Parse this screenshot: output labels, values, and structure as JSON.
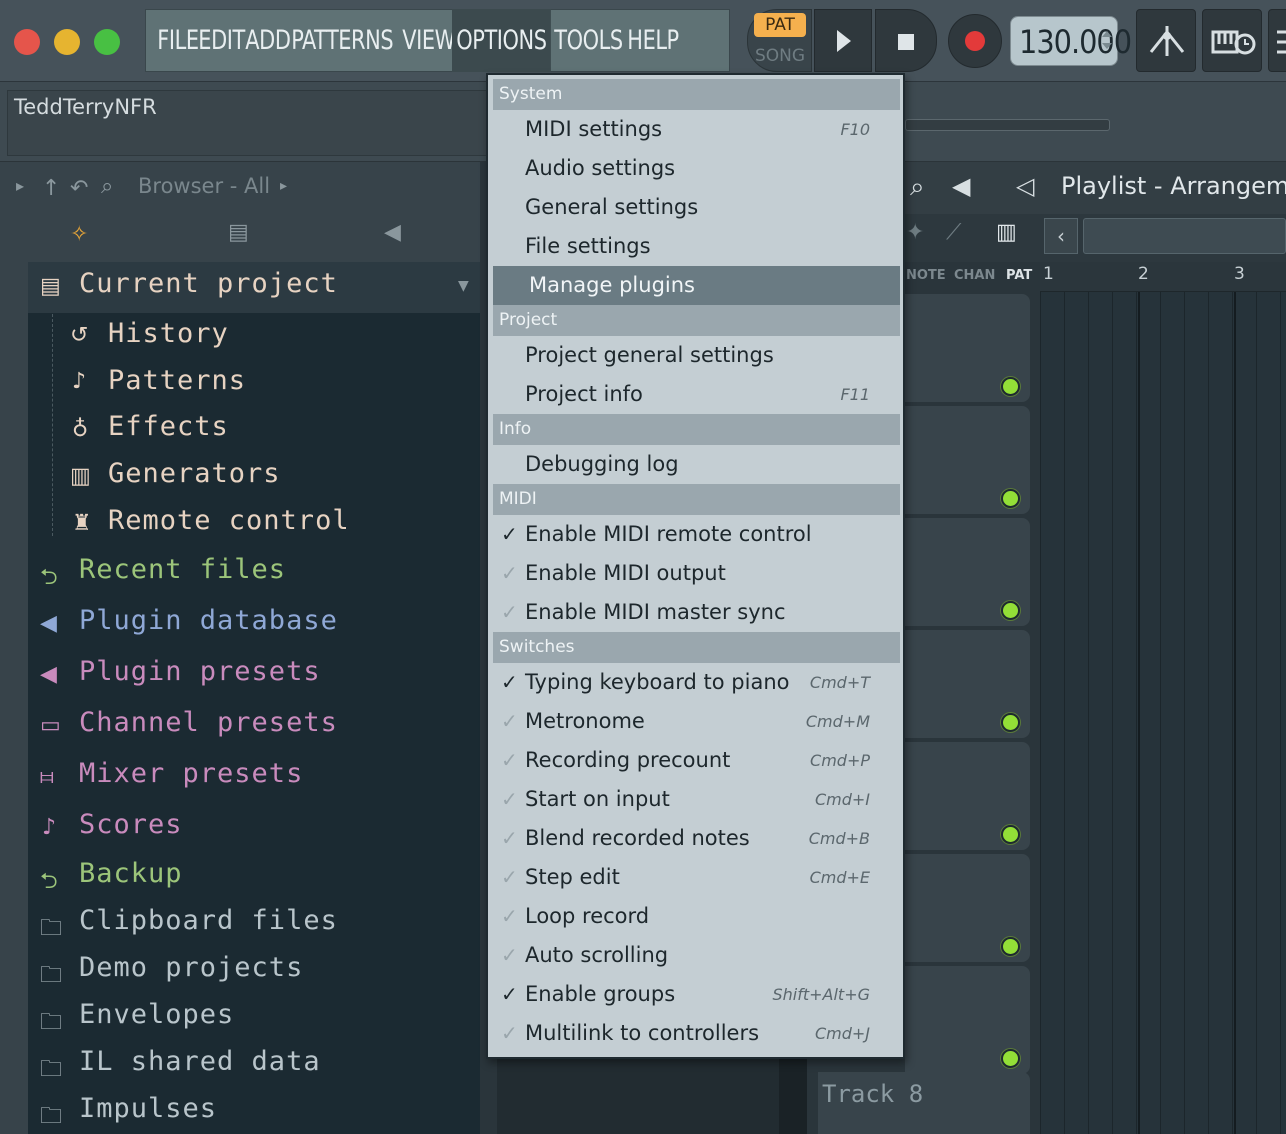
{
  "menubar": {
    "items": [
      "FILE",
      "EDIT",
      "ADD",
      "PATTERNS",
      "VIEW",
      "OPTIONS",
      "TOOLS",
      "HELP"
    ],
    "active": "OPTIONS"
  },
  "transport": {
    "pat": "PAT",
    "song": "SONG",
    "tempo": "130.000"
  },
  "hint": {
    "text": "TeddTerryNFR"
  },
  "browser": {
    "title": "Browser - All",
    "items": [
      {
        "label": "Current project",
        "color": "#e7d3c2"
      },
      {
        "label": "History",
        "color": "#e7d3c2"
      },
      {
        "label": "Patterns",
        "color": "#e7d3c2"
      },
      {
        "label": "Effects",
        "color": "#e7d3c2"
      },
      {
        "label": "Generators",
        "color": "#e7d3c2"
      },
      {
        "label": "Remote control",
        "color": "#e7d3c2"
      },
      {
        "label": "Recent files",
        "color": "#9cc57a"
      },
      {
        "label": "Plugin database",
        "color": "#8fa8d6"
      },
      {
        "label": "Plugin presets",
        "color": "#c98bbd"
      },
      {
        "label": "Channel presets",
        "color": "#c98bbd"
      },
      {
        "label": "Mixer presets",
        "color": "#c98bbd"
      },
      {
        "label": "Scores",
        "color": "#c98bbd"
      },
      {
        "label": "Backup",
        "color": "#9cc57a"
      },
      {
        "label": "Clipboard files",
        "color": "#b9c5cb"
      },
      {
        "label": "Demo projects",
        "color": "#b9c5cb"
      },
      {
        "label": "Envelopes",
        "color": "#b9c5cb"
      },
      {
        "label": "IL shared data",
        "color": "#b9c5cb"
      },
      {
        "label": "Impulses",
        "color": "#b9c5cb"
      }
    ]
  },
  "playlist": {
    "title": "Playlist - Arrangem",
    "toggles": [
      "NOTE",
      "CHAN",
      "PAT"
    ],
    "ruler": [
      "1",
      "2",
      "3"
    ],
    "track8": "Track 8"
  },
  "options_menu": {
    "sections": [
      {
        "title": "System",
        "items": [
          {
            "label": "MIDI settings",
            "shortcut": "F10",
            "check": null
          },
          {
            "label": "Audio settings",
            "shortcut": "",
            "check": null
          },
          {
            "label": "General settings",
            "shortcut": "",
            "check": null
          },
          {
            "label": "File settings",
            "shortcut": "",
            "check": null
          },
          {
            "label": "Manage plugins",
            "shortcut": "",
            "check": null,
            "highlighted": true
          }
        ]
      },
      {
        "title": "Project",
        "items": [
          {
            "label": "Project general settings",
            "shortcut": "",
            "check": null
          },
          {
            "label": "Project info",
            "shortcut": "F11",
            "check": null
          }
        ]
      },
      {
        "title": "Info",
        "items": [
          {
            "label": "Debugging log",
            "shortcut": "",
            "check": null
          }
        ]
      },
      {
        "title": "MIDI",
        "items": [
          {
            "label": "Enable MIDI remote control",
            "shortcut": "",
            "check": true
          },
          {
            "label": "Enable MIDI output",
            "shortcut": "",
            "check": false
          },
          {
            "label": "Enable MIDI master sync",
            "shortcut": "",
            "check": false
          }
        ]
      },
      {
        "title": "Switches",
        "items": [
          {
            "label": "Typing keyboard to piano",
            "shortcut": "Cmd+T",
            "check": true
          },
          {
            "label": "Metronome",
            "shortcut": "Cmd+M",
            "check": false
          },
          {
            "label": "Recording precount",
            "shortcut": "Cmd+P",
            "check": false
          },
          {
            "label": "Start on input",
            "shortcut": "Cmd+I",
            "check": false
          },
          {
            "label": "Blend recorded notes",
            "shortcut": "Cmd+B",
            "check": false
          },
          {
            "label": "Step edit",
            "shortcut": "Cmd+E",
            "check": false
          },
          {
            "label": "Loop record",
            "shortcut": "",
            "check": false
          },
          {
            "label": "Auto scrolling",
            "shortcut": "",
            "check": false
          },
          {
            "label": "Enable groups",
            "shortcut": "Shift+Alt+G",
            "check": true
          },
          {
            "label": "Multilink to controllers",
            "shortcut": "Cmd+J",
            "check": false
          }
        ]
      }
    ]
  }
}
